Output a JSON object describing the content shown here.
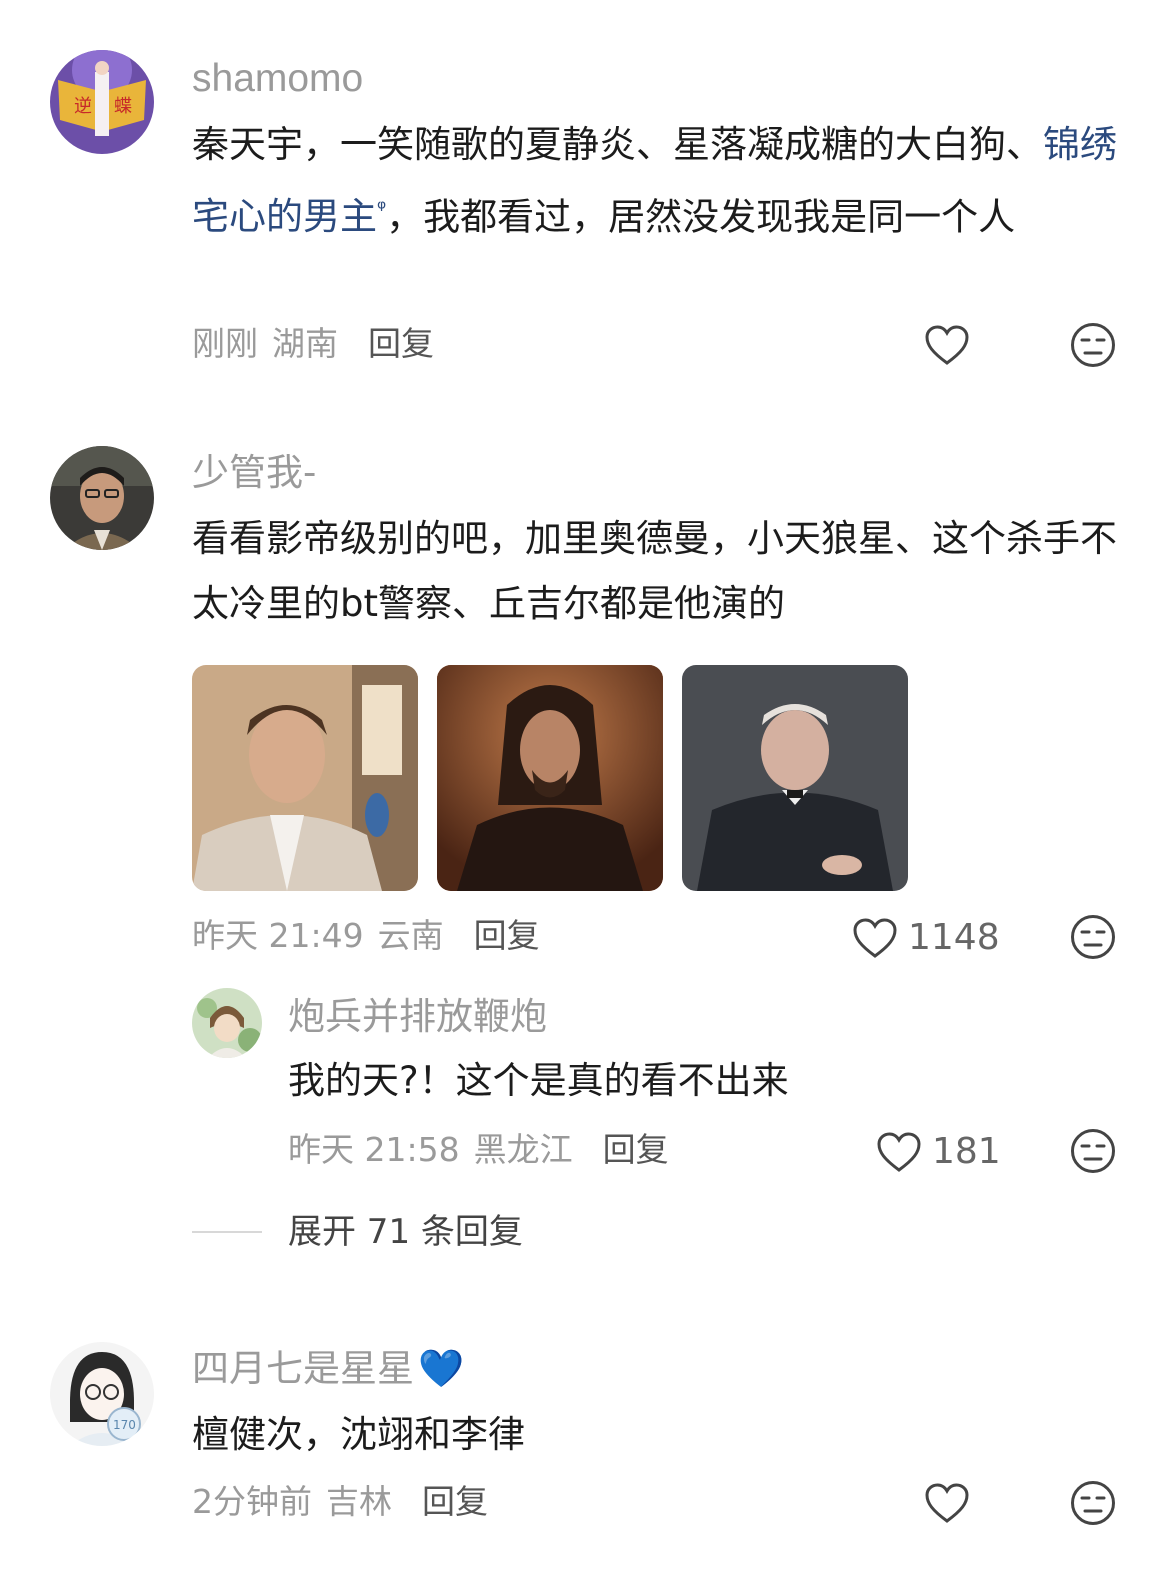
{
  "comments": [
    {
      "username": "shamomo",
      "text_before": "秦天宇，一笑随歌的夏静炎、星落凝成糖的大白狗、",
      "link_text": "锦绣宅心的男主",
      "text_after": "，我都看过，居然没发现我是同一个人",
      "time": "刚刚",
      "location": "湖南",
      "reply_label": "回复",
      "avatar_text_left": "逆",
      "avatar_text_right": "蝶"
    },
    {
      "username": "少管我-",
      "text": "看看影帝级别的吧，加里奥德曼，小天狼星、这个杀手不太冷里的bt警察、丘吉尔都是他演的",
      "time": "昨天 21:49",
      "location": "云南",
      "reply_label": "回复",
      "likes": "1148",
      "reply": {
        "username": "炮兵并排放鞭炮",
        "text": "我的天?！这个是真的看不出来",
        "time": "昨天 21:58",
        "location": "黑龙江",
        "reply_label": "回复",
        "likes": "181"
      },
      "expand_label": "展开 71 条回复"
    },
    {
      "username": "四月七是星星",
      "username_emoji": "💙",
      "text": "檀健次，沈翊和李律",
      "time": "2分钟前",
      "location": "吉林",
      "reply_label": "回复",
      "avatar_badge": "170"
    }
  ]
}
